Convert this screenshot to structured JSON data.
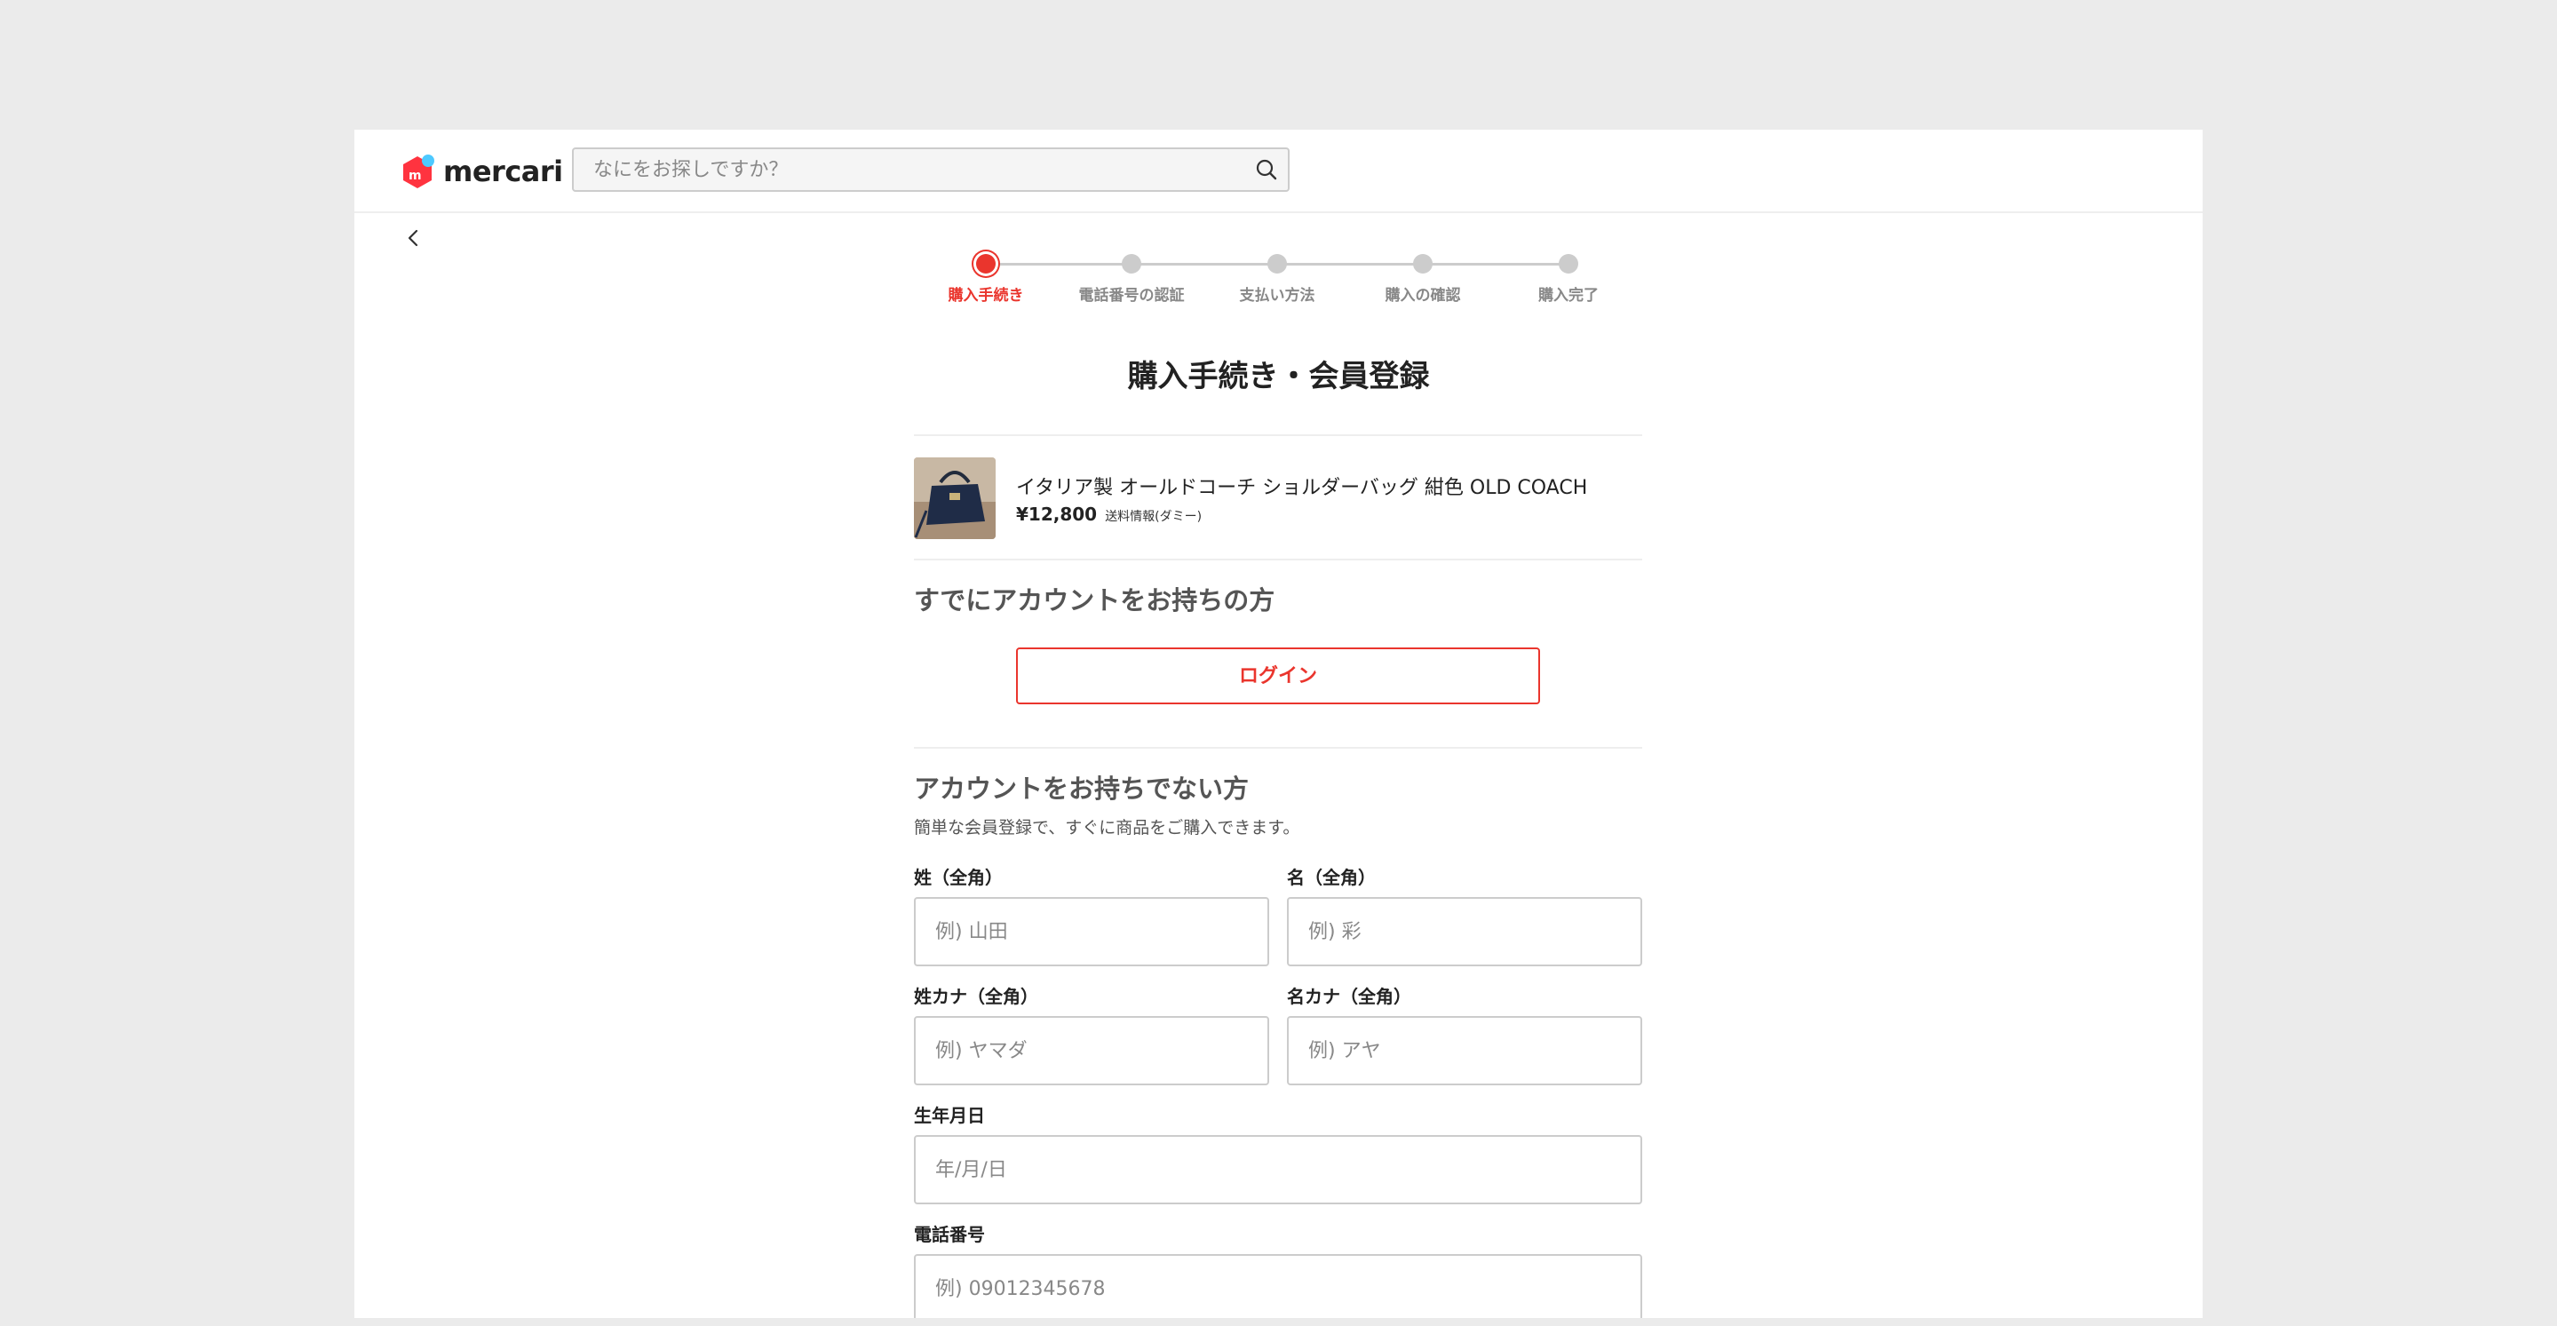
{
  "header": {
    "logo_text": "mercari",
    "search": {
      "placeholder": "なにをお探しですか？"
    }
  },
  "stepper": {
    "steps": [
      {
        "label": "購入手続き",
        "active": true
      },
      {
        "label": "電話番号の認証",
        "active": false
      },
      {
        "label": "支払い方法",
        "active": false
      },
      {
        "label": "購入の確認",
        "active": false
      },
      {
        "label": "購入完了",
        "active": false
      }
    ]
  },
  "page_title": "購入手続き・会員登録",
  "item": {
    "title": "イタリア製 オールドコーチ ショルダーバッグ 紺色 OLD COACH",
    "price": "¥12,800",
    "shipping": "送料情報(ダミー)"
  },
  "login_section": {
    "heading": "すでにアカウントをお持ちの方",
    "button_label": "ログイン"
  },
  "register_section": {
    "heading": "アカウントをお持ちでない方",
    "subtext": "簡単な会員登録で、すぐに商品をご購入できます。",
    "fields": {
      "last_name": {
        "label": "姓（全角）",
        "placeholder": "例) 山田"
      },
      "first_name": {
        "label": "名（全角）",
        "placeholder": "例) 彩"
      },
      "last_name_kana": {
        "label": "姓カナ（全角）",
        "placeholder": "例) ヤマダ"
      },
      "first_name_kana": {
        "label": "名カナ（全角）",
        "placeholder": "例) アヤ"
      },
      "birthdate": {
        "label": "生年月日",
        "placeholder": "年/月/日"
      },
      "phone": {
        "label": "電話番号",
        "placeholder": "例) 09012345678"
      }
    }
  },
  "colors": {
    "accent": "#ea352d",
    "background": "#ebebeb",
    "border": "#cccccc"
  },
  "icons": {
    "search": "search-icon",
    "back": "chevron-left-icon",
    "logo": "mercari-logo-icon"
  }
}
